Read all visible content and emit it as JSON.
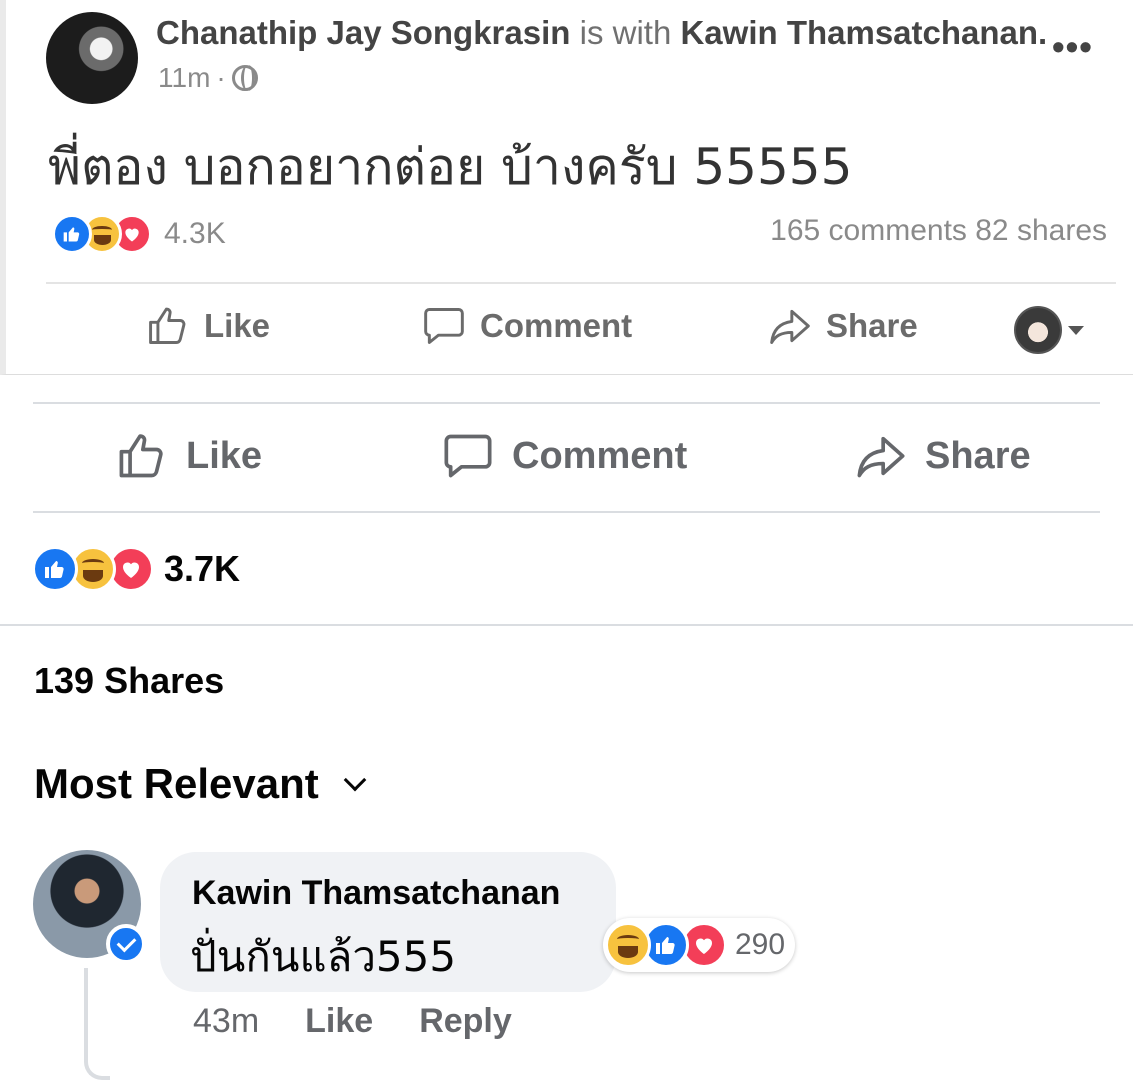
{
  "embedded_post": {
    "author": "Chanathip Jay Songkrasin",
    "with_label": "is with",
    "tagged": "Kawin Thamsatchanan.",
    "time": "11m",
    "meta_separator": "·",
    "text": "พี่ตอง บอกอยากต่อย บ้างครับ 55555",
    "reaction_count": "4.3K",
    "comments": "165 comments",
    "shares": "82 shares",
    "actions": {
      "like": "Like",
      "comment": "Comment",
      "share": "Share"
    }
  },
  "actions": {
    "like": "Like",
    "comment": "Comment",
    "share": "Share"
  },
  "reactions": {
    "total": "3.7K"
  },
  "shares": "139 Shares",
  "sort_label": "Most Relevant",
  "comment": {
    "author": "Kawin Thamsatchanan",
    "text": "ปั่นกันแล้ว555",
    "reaction_count": "290",
    "time": "43m",
    "like": "Like",
    "reply": "Reply"
  },
  "colors": {
    "like_blue": "#1877f2",
    "haha_yellow": "#f7c23e",
    "love_red": "#f33e58",
    "secondary_text": "#65676b",
    "bubble_bg": "#f0f2f5"
  }
}
